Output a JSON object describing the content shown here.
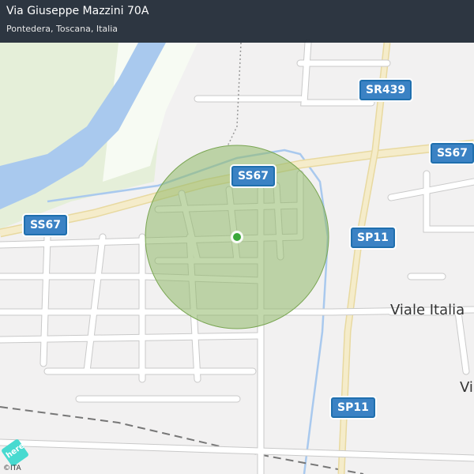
{
  "header": {
    "title": "Via Giuseppe Mazzini 70A",
    "subtitle": "Pontedera, Toscana, Italia"
  },
  "map": {
    "road_labels": [
      "SR439",
      "SS67",
      "SS67",
      "SS67",
      "SP11",
      "SP11"
    ],
    "street_labels": [
      "Viale Italia",
      "Vi"
    ],
    "attribution": "©ITA",
    "logo_text": "here",
    "colors": {
      "water": "#a9c9ee",
      "park": "#e4eed8",
      "circle": "#8fb868",
      "marker": "#3aa83a",
      "shield": "#3b82c4",
      "main_road": "#f3e9c2"
    }
  }
}
